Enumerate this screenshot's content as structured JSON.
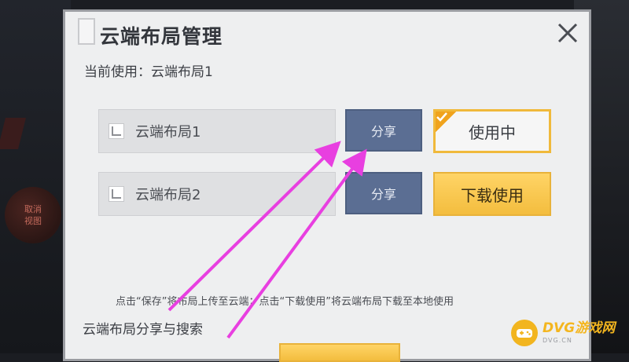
{
  "dialog": {
    "title": "云端布局管理",
    "close_icon": "close-icon",
    "current_label": "当前使用：云端布局1",
    "layouts": [
      {
        "name": "云端布局1",
        "share_label": "分享",
        "action_label": "使用中",
        "in_use": true
      },
      {
        "name": "云端布局2",
        "share_label": "分享",
        "action_label": "下载使用",
        "in_use": false
      }
    ],
    "hint": "点击“保存”将布局上传至云端；点击“下载使用”将云端布局下载至本地使用",
    "section_title": "云端布局分享与搜索"
  },
  "background": {
    "left_button_lines": [
      "取消",
      "视图"
    ]
  },
  "watermark": {
    "main": "DVG游戏网",
    "sub": "DVG.CN"
  },
  "colors": {
    "share_button": "#5b6e93",
    "accent_yellow": "#f3bd3e",
    "arrow": "#e83fe0"
  }
}
